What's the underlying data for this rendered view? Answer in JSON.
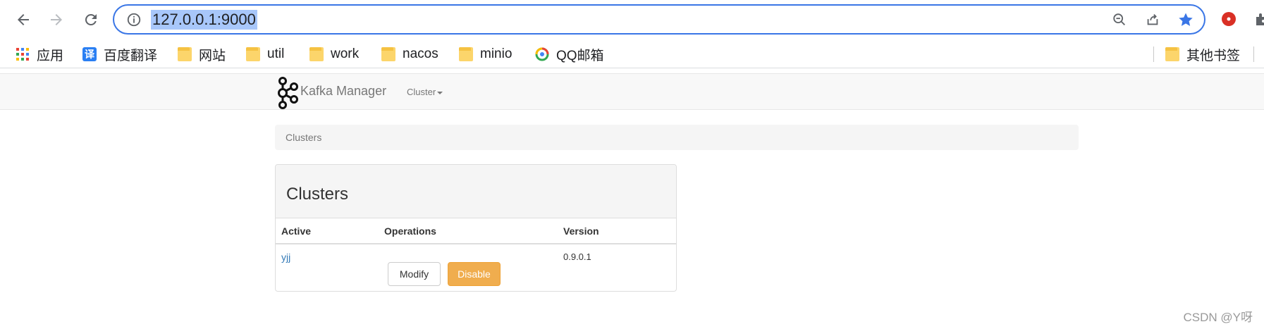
{
  "browser": {
    "url": "127.0.0.1:9000",
    "bookmarks": [
      {
        "label": "应用",
        "icon": "apps-grid-icon"
      },
      {
        "label": "百度翻译",
        "icon": "translate-icon"
      },
      {
        "label": "网站",
        "icon": "folder-icon"
      },
      {
        "label": "util",
        "icon": "folder-icon"
      },
      {
        "label": "work",
        "icon": "folder-icon"
      },
      {
        "label": "nacos",
        "icon": "folder-icon"
      },
      {
        "label": "minio",
        "icon": "folder-icon"
      },
      {
        "label": "QQ邮箱",
        "icon": "qq-mail-icon"
      }
    ],
    "other_bookmarks": "其他书签",
    "accent_color": "#3a76e6"
  },
  "app": {
    "brand": "Kafka Manager",
    "nav_cluster": "Cluster"
  },
  "breadcrumb": "Clusters",
  "panel": {
    "title": "Clusters",
    "columns": [
      "Active",
      "Operations",
      "Version"
    ],
    "rows": [
      {
        "name": "yjj",
        "modify": "Modify",
        "disable": "Disable",
        "version": "0.9.0.1"
      }
    ]
  },
  "watermark": "CSDN @Y呀"
}
